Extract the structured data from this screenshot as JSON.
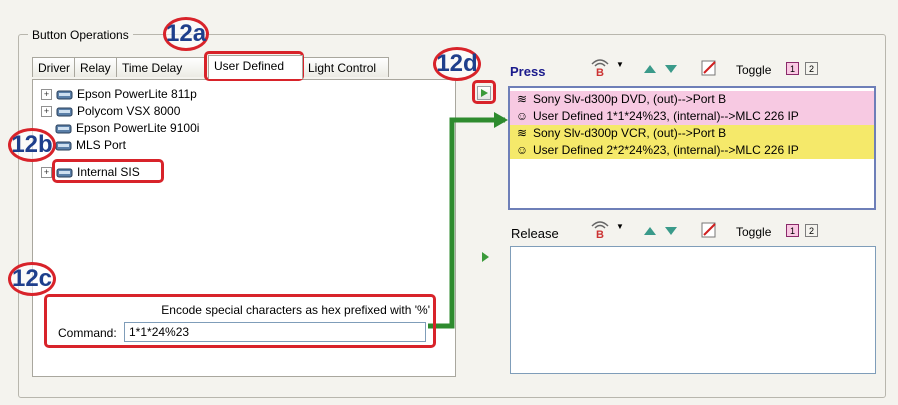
{
  "group_title": "Button Operations",
  "tabs": [
    {
      "label": "Driver"
    },
    {
      "label": "Relay"
    },
    {
      "label": "Time Delay"
    },
    {
      "label": "User Defined"
    },
    {
      "label": "Light Control"
    }
  ],
  "tree": {
    "items": [
      {
        "label": "Epson PowerLite 811p",
        "expander": "+"
      },
      {
        "label": "Polycom VSX 8000",
        "expander": "+"
      },
      {
        "label": "Epson PowerLite 9100i",
        "expander": ""
      },
      {
        "label": "MLS Port",
        "expander": ""
      },
      {
        "label": "Internal SIS",
        "expander": "+"
      }
    ]
  },
  "command": {
    "note": "Encode special characters as hex prefixed with '%'",
    "label": "Command:",
    "value": "1*1*24%23"
  },
  "press": {
    "label": "Press",
    "toggle_label": "Toggle",
    "toggle_1": "1",
    "toggle_2": "2",
    "rows": [
      {
        "text": "Sony Slv-d300p DVD, (out)-->Port B",
        "icon": "ir-icon",
        "bg": "#f7c9e2"
      },
      {
        "text": "User Defined 1*1*24%23, (internal)-->MLC 226 IP",
        "icon": "user-icon",
        "bg": "#f7c9e2"
      },
      {
        "text": "Sony Slv-d300p VCR, (out)-->Port B",
        "icon": "ir-icon",
        "bg": "#f5e96a"
      },
      {
        "text": "User Defined 2*2*24%23, (internal)-->MLC 226 IP",
        "icon": "user-icon",
        "bg": "#f5e96a"
      }
    ]
  },
  "release": {
    "label": "Release",
    "toggle_label": "Toggle",
    "toggle_1": "1",
    "toggle_2": "2"
  },
  "callouts": {
    "a": "12a",
    "b": "12b",
    "c": "12c",
    "d": "12d"
  },
  "colors": {
    "callout_red": "#d8232a",
    "callout_text": "#1f3f8c",
    "connector_green": "#2e8b2e",
    "press_pink": "#f7c9e2",
    "press_yellow": "#f5e96a"
  }
}
